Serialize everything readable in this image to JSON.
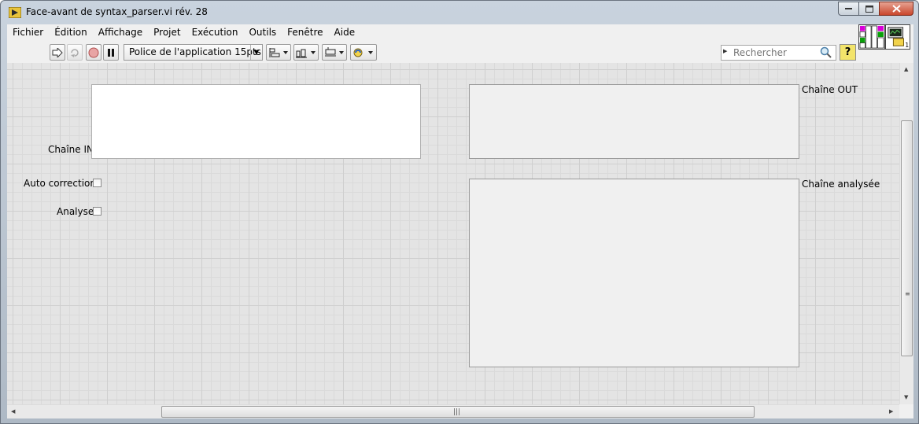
{
  "window": {
    "title": "Face-avant de syntax_parser.vi rév. 28"
  },
  "menu": [
    "Fichier",
    "Édition",
    "Affichage",
    "Projet",
    "Exécution",
    "Outils",
    "Fenêtre",
    "Aide"
  ],
  "toolbar": {
    "font": "Police de l'application 15pts",
    "search_placeholder": "Rechercher",
    "help": "?"
  },
  "panel": {
    "chaine_in_label": "Chaîne IN",
    "auto_correction_label": "Auto correction",
    "analyse_label": "Analyse",
    "chaine_out_label": "Chaîne OUT",
    "chaine_analysee_label": "Chaîne analysée",
    "vi_icon_number": "1"
  }
}
